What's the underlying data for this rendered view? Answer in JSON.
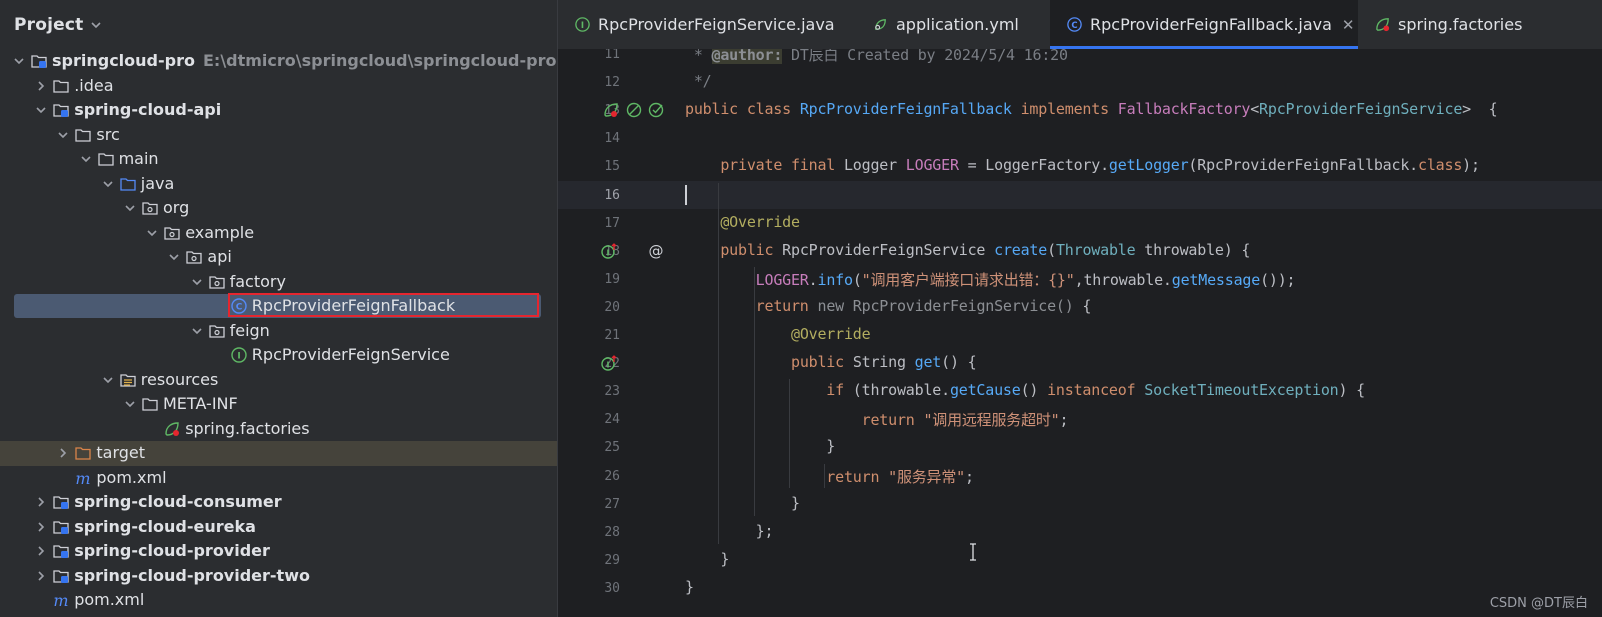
{
  "project_panel": {
    "title": "Project",
    "tree": [
      {
        "label": "springcloud-pro",
        "path": "E:\\dtmicro\\springcloud\\springcloud-pro",
        "bold": true,
        "icon": "module-folder-icon",
        "expanded": true,
        "depth": 0
      },
      {
        "label": ".idea",
        "bold": false,
        "icon": "folder-icon",
        "expanded": false,
        "depth": 1
      },
      {
        "label": "spring-cloud-api",
        "bold": true,
        "icon": "module-folder-icon",
        "expanded": true,
        "depth": 1
      },
      {
        "label": "src",
        "bold": false,
        "icon": "folder-icon",
        "expanded": true,
        "depth": 2
      },
      {
        "label": "main",
        "bold": false,
        "icon": "folder-icon",
        "expanded": true,
        "depth": 3
      },
      {
        "label": "java",
        "bold": false,
        "icon": "source-folder-icon",
        "expanded": true,
        "depth": 4
      },
      {
        "label": "org",
        "bold": false,
        "icon": "package-icon",
        "expanded": true,
        "depth": 5
      },
      {
        "label": "example",
        "bold": false,
        "icon": "package-icon",
        "expanded": true,
        "depth": 6
      },
      {
        "label": "api",
        "bold": false,
        "icon": "package-icon",
        "expanded": true,
        "depth": 7
      },
      {
        "label": "factory",
        "bold": false,
        "icon": "package-icon",
        "expanded": true,
        "depth": 8
      },
      {
        "label": "RpcProviderFeignFallback",
        "bold": false,
        "icon": "class-icon",
        "selected": true,
        "depth": 9
      },
      {
        "label": "feign",
        "bold": false,
        "icon": "package-icon",
        "expanded": true,
        "depth": 8
      },
      {
        "label": "RpcProviderFeignService",
        "bold": false,
        "icon": "interface-icon",
        "depth": 9
      },
      {
        "label": "resources",
        "bold": false,
        "icon": "resources-folder-icon",
        "expanded": true,
        "depth": 4
      },
      {
        "label": "META-INF",
        "bold": false,
        "icon": "folder-icon",
        "expanded": true,
        "depth": 5
      },
      {
        "label": "spring.factories",
        "bold": false,
        "icon": "spring-icon",
        "depth": 6
      },
      {
        "label": "target",
        "bold": false,
        "icon": "excluded-folder-icon",
        "expanded": false,
        "depth": 2,
        "highlight": true
      },
      {
        "label": "pom.xml",
        "bold": false,
        "icon": "maven-icon",
        "depth": 2
      },
      {
        "label": "spring-cloud-consumer",
        "bold": true,
        "icon": "module-folder-icon",
        "expanded": false,
        "depth": 1
      },
      {
        "label": "spring-cloud-eureka",
        "bold": true,
        "icon": "module-folder-icon",
        "expanded": false,
        "depth": 1
      },
      {
        "label": "spring-cloud-provider",
        "bold": true,
        "icon": "module-folder-icon",
        "expanded": false,
        "depth": 1
      },
      {
        "label": "spring-cloud-provider-two",
        "bold": true,
        "icon": "module-folder-icon",
        "expanded": false,
        "depth": 1
      },
      {
        "label": "pom.xml",
        "bold": false,
        "icon": "maven-icon",
        "depth": 1
      }
    ]
  },
  "tabs": [
    {
      "label": "RpcProviderFeignService.java",
      "icon": "interface-icon",
      "active": false
    },
    {
      "label": "application.yml",
      "icon": "spring-boot-icon",
      "active": false
    },
    {
      "label": "RpcProviderFeignFallback.java",
      "icon": "class-icon",
      "active": true,
      "close": "✕"
    },
    {
      "label": "spring.factories",
      "icon": "spring-icon",
      "active": false
    }
  ],
  "editor": {
    "current_line": 16,
    "lines": [
      {
        "n": "11",
        "tokens": [
          [
            "cmt",
            " * "
          ],
          [
            "tag",
            "@author:"
          ],
          [
            "cmt",
            " DT辰白 Created by 2024/5/4 16:20"
          ]
        ]
      },
      {
        "n": "12",
        "tokens": [
          [
            "cmt",
            " */"
          ]
        ]
      },
      {
        "n": "13",
        "tokens": [
          [
            "kw",
            "public class "
          ],
          [
            "fn",
            "RpcProviderFeignFallback "
          ],
          [
            "kw",
            "implements "
          ],
          [
            "cls",
            "FallbackFactory"
          ],
          [
            "txt",
            "<"
          ],
          [
            "cls2",
            "RpcProviderFeignService"
          ],
          [
            "txt",
            ">  {"
          ]
        ]
      },
      {
        "n": "14",
        "tokens": []
      },
      {
        "n": "15",
        "tokens": [
          [
            "txt",
            "    "
          ],
          [
            "kw",
            "private final "
          ],
          [
            "txt",
            "Logger "
          ],
          [
            "fld",
            "LOGGER"
          ],
          [
            "txt",
            " = LoggerFactory."
          ],
          [
            "meth",
            "getLogger"
          ],
          [
            "txt",
            "(RpcProviderFeignFallback."
          ],
          [
            "kw",
            "class"
          ],
          [
            "txt",
            ");"
          ]
        ]
      },
      {
        "n": "16",
        "tokens": []
      },
      {
        "n": "17",
        "tokens": [
          [
            "txt",
            "    "
          ],
          [
            "ann",
            "@Override"
          ]
        ]
      },
      {
        "n": "18",
        "tokens": [
          [
            "txt",
            "    "
          ],
          [
            "kw",
            "public "
          ],
          [
            "txt",
            "RpcProviderFeignService "
          ],
          [
            "fn",
            "create"
          ],
          [
            "txt",
            "("
          ],
          [
            "cls2",
            "Throwable"
          ],
          [
            "txt",
            " throwable) {"
          ]
        ]
      },
      {
        "n": "19",
        "tokens": [
          [
            "txt",
            "        "
          ],
          [
            "fld",
            "LOGGER"
          ],
          [
            "txt",
            "."
          ],
          [
            "meth",
            "info"
          ],
          [
            "txt",
            "("
          ],
          [
            "strc",
            "\"调用客户端接口请求出错：{}\""
          ],
          [
            "txt",
            ",throwable."
          ],
          [
            "meth",
            "getMessage"
          ],
          [
            "txt",
            "());"
          ]
        ]
      },
      {
        "n": "20",
        "tokens": [
          [
            "txt",
            "        "
          ],
          [
            "kw",
            "return "
          ],
          [
            "dim",
            "new RpcProviderFeignService() "
          ],
          [
            "txt",
            "{"
          ]
        ]
      },
      {
        "n": "21",
        "tokens": [
          [
            "txt",
            "            "
          ],
          [
            "ann",
            "@Override"
          ]
        ]
      },
      {
        "n": "22",
        "tokens": [
          [
            "txt",
            "            "
          ],
          [
            "kw",
            "public "
          ],
          [
            "txt",
            "String "
          ],
          [
            "fn",
            "get"
          ],
          [
            "txt",
            "() {"
          ]
        ]
      },
      {
        "n": "23",
        "tokens": [
          [
            "txt",
            "                "
          ],
          [
            "kw",
            "if "
          ],
          [
            "txt",
            "(throwable."
          ],
          [
            "meth",
            "getCause"
          ],
          [
            "txt",
            "() "
          ],
          [
            "kw",
            "instanceof "
          ],
          [
            "cls2",
            "SocketTimeoutException"
          ],
          [
            "txt",
            ") {"
          ]
        ]
      },
      {
        "n": "24",
        "tokens": [
          [
            "txt",
            "                    "
          ],
          [
            "kw",
            "return "
          ],
          [
            "strc",
            "\"调用远程服务超时\""
          ],
          [
            "txt",
            ";"
          ]
        ]
      },
      {
        "n": "25",
        "tokens": [
          [
            "txt",
            "                }"
          ]
        ]
      },
      {
        "n": "26",
        "tokens": [
          [
            "txt",
            "                "
          ],
          [
            "kw",
            "return "
          ],
          [
            "strc",
            "\"服务异常\""
          ],
          [
            "txt",
            ";"
          ]
        ]
      },
      {
        "n": "27",
        "tokens": [
          [
            "txt",
            "            }"
          ]
        ]
      },
      {
        "n": "28",
        "tokens": [
          [
            "txt",
            "        };"
          ]
        ]
      },
      {
        "n": "29",
        "tokens": [
          [
            "txt",
            "    }"
          ]
        ]
      },
      {
        "n": "30",
        "tokens": [
          [
            "txt",
            "}"
          ]
        ]
      }
    ]
  },
  "watermark": "CSDN @DT辰白",
  "colors": {
    "panel_bg": "#2b2d30",
    "editor_bg": "#1e1f22",
    "selection": "#4b5a72",
    "highlight_box": "#e5262f",
    "tab_underline": "#3574f0",
    "keyword": "#cf8e6d",
    "string": "#ce9178",
    "annotation": "#b3ae60"
  }
}
